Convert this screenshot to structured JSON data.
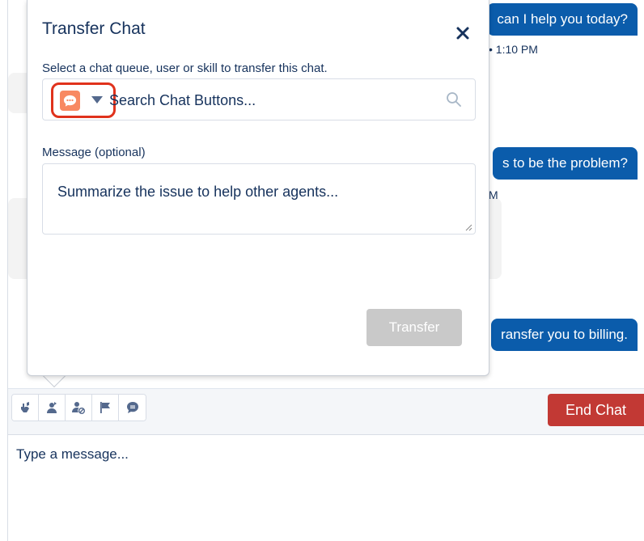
{
  "transcript": {
    "messages": [
      {
        "text": "can I help you today?",
        "time": "• 1:10 PM"
      },
      {
        "text": "s to be the problem?",
        "time": "M"
      },
      {
        "text": "ransfer you to billing.",
        "time": ""
      }
    ]
  },
  "popover": {
    "title": "Transfer Chat",
    "close_icon": "close-icon",
    "select_label": "Select a chat queue, user or skill to transfer this chat.",
    "type_icon": "chat-bubble-icon",
    "type_icon_color": "#f88962",
    "search_placeholder": "Search Chat Buttons...",
    "message_label": "Message (optional)",
    "message_placeholder": "Summarize the issue to help other agents...",
    "transfer_label": "Transfer"
  },
  "toolbar": {
    "tools": [
      {
        "icon": "raise-flag-hand-icon"
      },
      {
        "icon": "transfer-user-icon"
      },
      {
        "icon": "block-user-icon"
      },
      {
        "icon": "flag-icon"
      },
      {
        "icon": "quick-text-icon"
      }
    ],
    "end_chat_label": "End Chat",
    "end_chat_color": "#c23934"
  },
  "composer": {
    "placeholder": "Type a message..."
  }
}
